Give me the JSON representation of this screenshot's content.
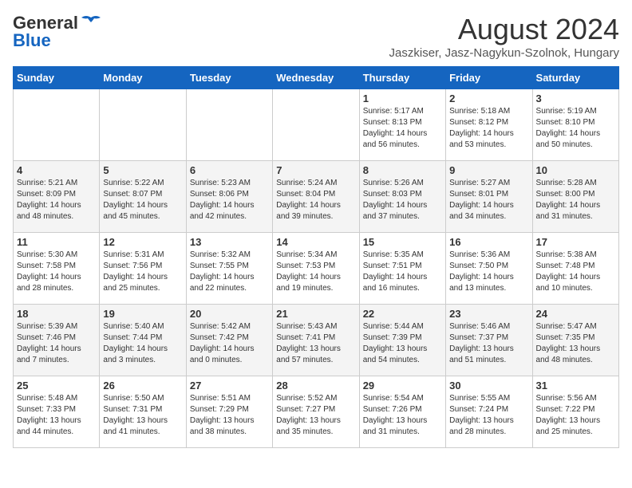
{
  "header": {
    "logo_general": "General",
    "logo_blue": "Blue",
    "month_title": "August 2024",
    "subtitle": "Jaszkiser, Jasz-Nagykun-Szolnok, Hungary"
  },
  "weekdays": [
    "Sunday",
    "Monday",
    "Tuesday",
    "Wednesday",
    "Thursday",
    "Friday",
    "Saturday"
  ],
  "weeks": [
    [
      {
        "day": "",
        "info": ""
      },
      {
        "day": "",
        "info": ""
      },
      {
        "day": "",
        "info": ""
      },
      {
        "day": "",
        "info": ""
      },
      {
        "day": "1",
        "info": "Sunrise: 5:17 AM\nSunset: 8:13 PM\nDaylight: 14 hours\nand 56 minutes."
      },
      {
        "day": "2",
        "info": "Sunrise: 5:18 AM\nSunset: 8:12 PM\nDaylight: 14 hours\nand 53 minutes."
      },
      {
        "day": "3",
        "info": "Sunrise: 5:19 AM\nSunset: 8:10 PM\nDaylight: 14 hours\nand 50 minutes."
      }
    ],
    [
      {
        "day": "4",
        "info": "Sunrise: 5:21 AM\nSunset: 8:09 PM\nDaylight: 14 hours\nand 48 minutes."
      },
      {
        "day": "5",
        "info": "Sunrise: 5:22 AM\nSunset: 8:07 PM\nDaylight: 14 hours\nand 45 minutes."
      },
      {
        "day": "6",
        "info": "Sunrise: 5:23 AM\nSunset: 8:06 PM\nDaylight: 14 hours\nand 42 minutes."
      },
      {
        "day": "7",
        "info": "Sunrise: 5:24 AM\nSunset: 8:04 PM\nDaylight: 14 hours\nand 39 minutes."
      },
      {
        "day": "8",
        "info": "Sunrise: 5:26 AM\nSunset: 8:03 PM\nDaylight: 14 hours\nand 37 minutes."
      },
      {
        "day": "9",
        "info": "Sunrise: 5:27 AM\nSunset: 8:01 PM\nDaylight: 14 hours\nand 34 minutes."
      },
      {
        "day": "10",
        "info": "Sunrise: 5:28 AM\nSunset: 8:00 PM\nDaylight: 14 hours\nand 31 minutes."
      }
    ],
    [
      {
        "day": "11",
        "info": "Sunrise: 5:30 AM\nSunset: 7:58 PM\nDaylight: 14 hours\nand 28 minutes."
      },
      {
        "day": "12",
        "info": "Sunrise: 5:31 AM\nSunset: 7:56 PM\nDaylight: 14 hours\nand 25 minutes."
      },
      {
        "day": "13",
        "info": "Sunrise: 5:32 AM\nSunset: 7:55 PM\nDaylight: 14 hours\nand 22 minutes."
      },
      {
        "day": "14",
        "info": "Sunrise: 5:34 AM\nSunset: 7:53 PM\nDaylight: 14 hours\nand 19 minutes."
      },
      {
        "day": "15",
        "info": "Sunrise: 5:35 AM\nSunset: 7:51 PM\nDaylight: 14 hours\nand 16 minutes."
      },
      {
        "day": "16",
        "info": "Sunrise: 5:36 AM\nSunset: 7:50 PM\nDaylight: 14 hours\nand 13 minutes."
      },
      {
        "day": "17",
        "info": "Sunrise: 5:38 AM\nSunset: 7:48 PM\nDaylight: 14 hours\nand 10 minutes."
      }
    ],
    [
      {
        "day": "18",
        "info": "Sunrise: 5:39 AM\nSunset: 7:46 PM\nDaylight: 14 hours\nand 7 minutes."
      },
      {
        "day": "19",
        "info": "Sunrise: 5:40 AM\nSunset: 7:44 PM\nDaylight: 14 hours\nand 3 minutes."
      },
      {
        "day": "20",
        "info": "Sunrise: 5:42 AM\nSunset: 7:42 PM\nDaylight: 14 hours\nand 0 minutes."
      },
      {
        "day": "21",
        "info": "Sunrise: 5:43 AM\nSunset: 7:41 PM\nDaylight: 13 hours\nand 57 minutes."
      },
      {
        "day": "22",
        "info": "Sunrise: 5:44 AM\nSunset: 7:39 PM\nDaylight: 13 hours\nand 54 minutes."
      },
      {
        "day": "23",
        "info": "Sunrise: 5:46 AM\nSunset: 7:37 PM\nDaylight: 13 hours\nand 51 minutes."
      },
      {
        "day": "24",
        "info": "Sunrise: 5:47 AM\nSunset: 7:35 PM\nDaylight: 13 hours\nand 48 minutes."
      }
    ],
    [
      {
        "day": "25",
        "info": "Sunrise: 5:48 AM\nSunset: 7:33 PM\nDaylight: 13 hours\nand 44 minutes."
      },
      {
        "day": "26",
        "info": "Sunrise: 5:50 AM\nSunset: 7:31 PM\nDaylight: 13 hours\nand 41 minutes."
      },
      {
        "day": "27",
        "info": "Sunrise: 5:51 AM\nSunset: 7:29 PM\nDaylight: 13 hours\nand 38 minutes."
      },
      {
        "day": "28",
        "info": "Sunrise: 5:52 AM\nSunset: 7:27 PM\nDaylight: 13 hours\nand 35 minutes."
      },
      {
        "day": "29",
        "info": "Sunrise: 5:54 AM\nSunset: 7:26 PM\nDaylight: 13 hours\nand 31 minutes."
      },
      {
        "day": "30",
        "info": "Sunrise: 5:55 AM\nSunset: 7:24 PM\nDaylight: 13 hours\nand 28 minutes."
      },
      {
        "day": "31",
        "info": "Sunrise: 5:56 AM\nSunset: 7:22 PM\nDaylight: 13 hours\nand 25 minutes."
      }
    ]
  ]
}
